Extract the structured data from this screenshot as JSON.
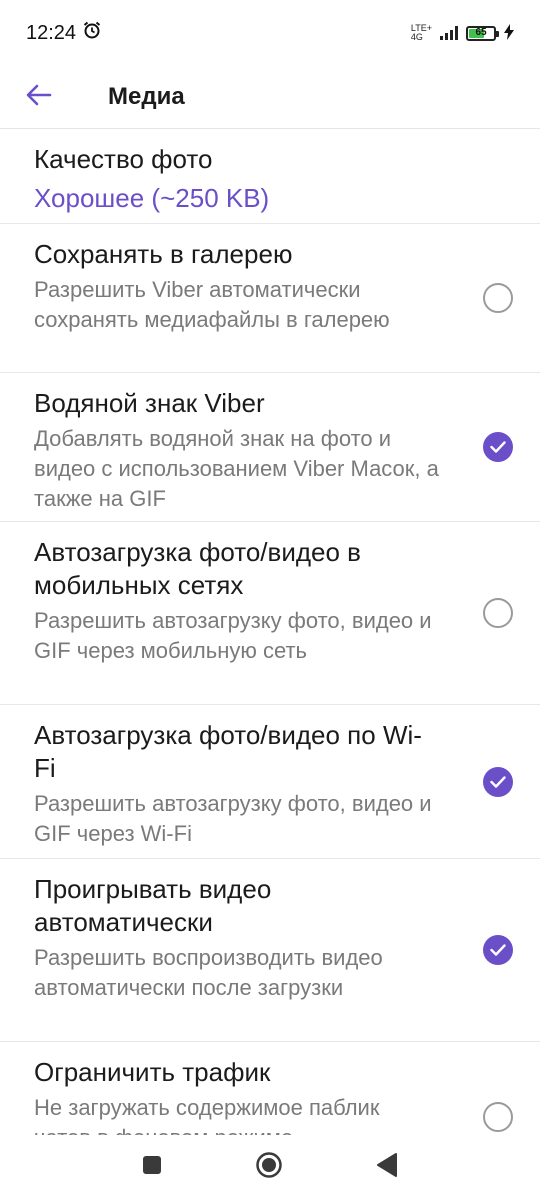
{
  "status_bar": {
    "time": "12:24",
    "network": "LTE+",
    "network_sub": "4G",
    "battery_level": "65",
    "battery_fraction": 0.65,
    "icons": [
      "alarm-icon",
      "signal-icon",
      "battery-icon",
      "charging-icon"
    ]
  },
  "app_bar": {
    "title": "Медиа",
    "back_icon": "arrow-left-icon",
    "accent_color": "#6a4fc9"
  },
  "settings": {
    "photo_quality": {
      "title": "Качество фото",
      "value": "Хорошее (~250 KB)"
    },
    "items": [
      {
        "title": "Сохранять в галерею",
        "description": "Разрешить Viber автоматически сохранять медиафайлы в галерею",
        "checked": false
      },
      {
        "title": "Водяной знак Viber",
        "description": "Добавлять водяной знак на фото и видео с использованием Viber Масок, а также на GIF",
        "checked": true
      },
      {
        "title": "Автозагрузка фото/видео в мобильных сетях",
        "description": "Разрешить автозагрузку фото, видео и GIF через мобильную сеть",
        "checked": false
      },
      {
        "title": "Автозагрузка фото/видео по Wi-Fi",
        "description": "Разрешить автозагрузку фото, видео и GIF через Wi-Fi",
        "checked": true
      },
      {
        "title": "Проигрывать видео автоматически",
        "description": "Разрешить воспроизводить видео автоматически после загрузки",
        "checked": true
      },
      {
        "title": "Ограничить трафик",
        "description": "Не загружать содержимое паблик чатов в фоновом режиме",
        "checked": false
      }
    ]
  },
  "nav_bar": {
    "buttons": [
      "recents-square-icon",
      "home-circle-icon",
      "back-triangle-icon"
    ]
  }
}
